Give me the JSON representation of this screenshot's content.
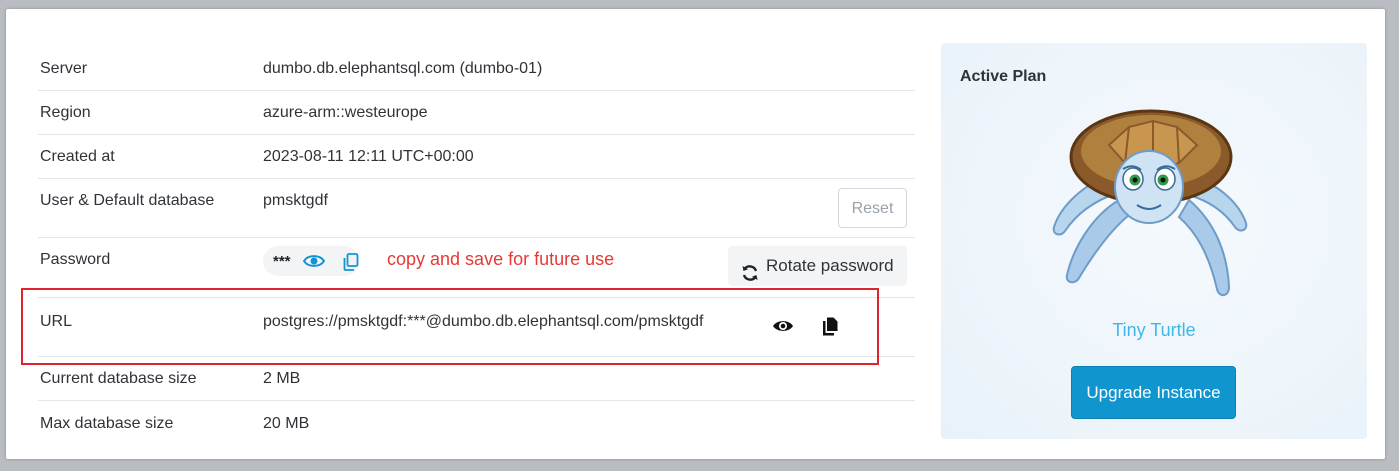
{
  "details": {
    "server": {
      "label": "Server",
      "value": "dumbo.db.elephantsql.com (dumbo-01)"
    },
    "region": {
      "label": "Region",
      "value": "azure-arm::westeurope"
    },
    "created": {
      "label": "Created at",
      "value": "2023-08-11 12:11 UTC+00:00"
    },
    "user": {
      "label": "User & Default database",
      "value": "pmsktgdf",
      "reset_label": "Reset"
    },
    "password": {
      "label": "Password",
      "masked": "***",
      "note": "copy and save for future use",
      "rotate_label": "Rotate password"
    },
    "url": {
      "label": "URL",
      "value": "postgres://pmsktgdf:***@dumbo.db.elephantsql.com/pmsktgdf"
    },
    "current_size": {
      "label": "Current database size",
      "value": "2 MB"
    },
    "max_size": {
      "label": "Max database size",
      "value": "20 MB"
    }
  },
  "plan": {
    "title": "Active Plan",
    "name": "Tiny Turtle",
    "upgrade_label": "Upgrade Instance"
  },
  "colors": {
    "accent": "#1195cf",
    "plan_name": "#3fb7e6",
    "note": "#e53935",
    "highlight": "#e0242d"
  },
  "icons": [
    "eye-icon",
    "copy-icon",
    "rotate-icon",
    "turtle-mascot"
  ]
}
